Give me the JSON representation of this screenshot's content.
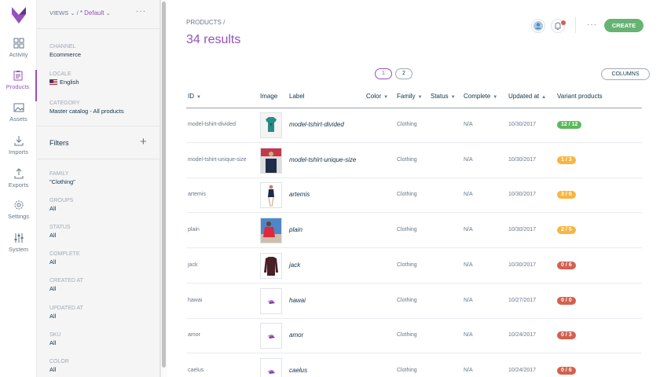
{
  "nav": {
    "items": [
      {
        "label": "Activity",
        "icon": "dashboard-icon"
      },
      {
        "label": "Products",
        "icon": "clipboard-icon",
        "active": true
      },
      {
        "label": "Assets",
        "icon": "image-icon"
      },
      {
        "label": "Imports",
        "icon": "import-icon"
      },
      {
        "label": "Exports",
        "icon": "export-icon"
      },
      {
        "label": "Settings",
        "icon": "gear-icon"
      },
      {
        "label": "System",
        "icon": "sliders-icon"
      }
    ]
  },
  "panel": {
    "views_label": "VIEWS",
    "view_name": "* Default",
    "more": "···",
    "channel": {
      "label": "CHANNEL",
      "value": "Ecommerce"
    },
    "locale": {
      "label": "LOCALE",
      "value": "English"
    },
    "category": {
      "label": "CATEGORY",
      "value": "Master catalog - All products"
    },
    "filters_title": "Filters",
    "filters": [
      {
        "label": "FAMILY",
        "value": "\"Clothing\""
      },
      {
        "label": "GROUPS",
        "value": "All"
      },
      {
        "label": "STATUS",
        "value": "All"
      },
      {
        "label": "COMPLETE",
        "value": "All"
      },
      {
        "label": "CREATED AT",
        "value": "All"
      },
      {
        "label": "UPDATED AT",
        "value": "All"
      },
      {
        "label": "SKU",
        "value": "All"
      },
      {
        "label": "COLOR",
        "value": "All"
      }
    ]
  },
  "main": {
    "breadcrumb": "PRODUCTS /",
    "results": "34 results",
    "more": "···",
    "create_label": "CREATE",
    "pages": [
      "1",
      "2"
    ],
    "columns_label": "COLUMNS"
  },
  "table": {
    "headers": {
      "id": "ID",
      "image": "Image",
      "label": "Label",
      "color": "Color",
      "family": "Family",
      "status": "Status",
      "complete": "Complete",
      "updated": "Updated at",
      "variants": "Variant products"
    },
    "rows": [
      {
        "id": "model-tshirt-divided",
        "label": "model-tshirt-divided",
        "family": "Clothing",
        "complete": "N/A",
        "updated": "10/30/2017",
        "variants": "12 / 12",
        "badge_color": "#5cb85c",
        "img": "tshirt"
      },
      {
        "id": "model-tshirt-unique-size",
        "label": "model-tshirt-unique-size",
        "family": "Clothing",
        "complete": "N/A",
        "updated": "10/30/2017",
        "variants": "1 / 3",
        "badge_color": "#f9b53f",
        "img": "man"
      },
      {
        "id": "artemis",
        "label": "artemis",
        "family": "Clothing",
        "complete": "N/A",
        "updated": "10/30/2017",
        "variants": "3 / 6",
        "badge_color": "#f9b53f",
        "img": "woman"
      },
      {
        "id": "plain",
        "label": "plain",
        "family": "Clothing",
        "complete": "N/A",
        "updated": "10/30/2017",
        "variants": "2 / 5",
        "badge_color": "#f9b53f",
        "img": "red"
      },
      {
        "id": "jack",
        "label": "jack",
        "family": "Clothing",
        "complete": "N/A",
        "updated": "10/30/2017",
        "variants": "0 / 6",
        "badge_color": "#d4604f",
        "img": "sweater"
      },
      {
        "id": "hawai",
        "label": "hawai",
        "family": "Clothing",
        "complete": "N/A",
        "updated": "10/27/2017",
        "variants": "0 / 0",
        "badge_color": "#d4604f",
        "img": "placeholder"
      },
      {
        "id": "amor",
        "label": "amor",
        "family": "Clothing",
        "complete": "N/A",
        "updated": "10/24/2017",
        "variants": "0 / 3",
        "badge_color": "#d4604f",
        "img": "placeholder"
      },
      {
        "id": "caelus",
        "label": "caelus",
        "family": "Clothing",
        "complete": "N/A",
        "updated": "10/24/2017",
        "variants": "0 / 6",
        "badge_color": "#d4604f",
        "img": "placeholder"
      }
    ]
  }
}
